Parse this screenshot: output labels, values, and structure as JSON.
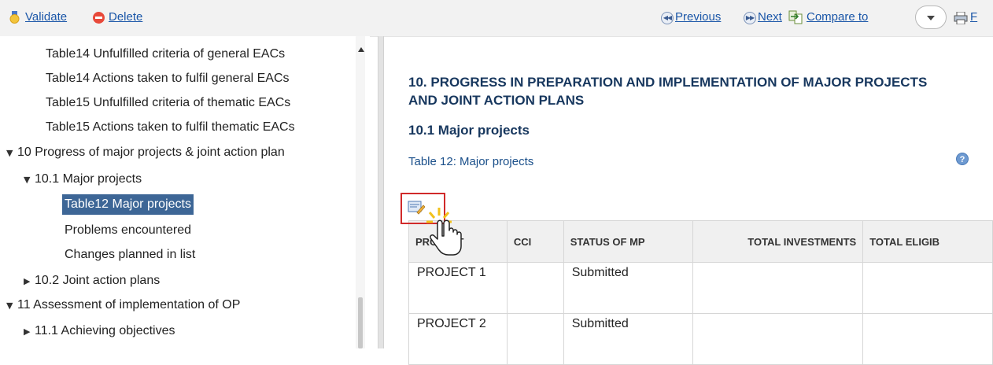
{
  "toolbar": {
    "validate_label": "Validate",
    "delete_label": "Delete",
    "previous_label": "Previous",
    "next_label": "Next",
    "compare_label": "Compare to",
    "print_label_partial": "F"
  },
  "tree": {
    "items": [
      {
        "label": "Table14 Unfulfilled criteria of general EACs"
      },
      {
        "label": "Table14 Actions taken to fulfil general EACs"
      },
      {
        "label": "Table15 Unfulfilled criteria of thematic EACs"
      },
      {
        "label": "Table15 Actions taken to fulfil thematic EACs"
      },
      {
        "label": "10 Progress of major projects & joint action plan",
        "toggle": "▼"
      },
      {
        "label": "10.1 Major projects",
        "toggle": "▼"
      },
      {
        "label": "Table12 Major projects",
        "selected": true
      },
      {
        "label": "Problems encountered"
      },
      {
        "label": "Changes planned in list"
      },
      {
        "label": "10.2 Joint action plans",
        "toggle": "▶"
      },
      {
        "label": "11 Assessment of implementation of OP",
        "toggle": "▼"
      },
      {
        "label": "11.1 Achieving objectives",
        "toggle": "▶"
      }
    ]
  },
  "content": {
    "title": "10. PROGRESS IN PREPARATION AND IMPLEMENTATION OF MAJOR PROJECTS AND JOINT ACTION PLANS",
    "subtitle": "10.1 Major projects",
    "table_caption": "Table 12: Major projects",
    "help_symbol": "?",
    "table": {
      "headers": [
        "PROJECT",
        "CCI",
        "STATUS OF MP",
        "TOTAL INVESTMENTS",
        "TOTAL ELIGIB"
      ],
      "rows": [
        [
          "PROJECT 1",
          "",
          "Submitted",
          "",
          ""
        ],
        [
          "PROJECT 2",
          "",
          "Submitted",
          "",
          ""
        ]
      ]
    }
  },
  "colors": {
    "link": "#1a56a8",
    "heading": "#17375e",
    "selected_bg": "#3d6696",
    "highlight_border": "#d12a2a"
  }
}
